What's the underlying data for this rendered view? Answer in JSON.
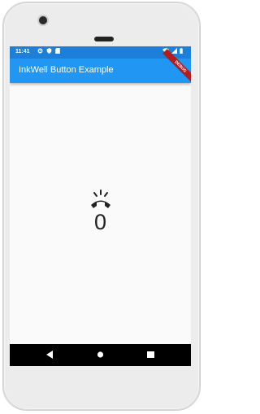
{
  "status_bar": {
    "time": "11:41"
  },
  "app_bar": {
    "title": "InkWell Button Example",
    "debug_label": "DEBUG"
  },
  "body": {
    "counter": "0",
    "icon": "ring-volume-icon"
  },
  "nav_bar": {
    "buttons": [
      "back",
      "home",
      "recents"
    ]
  },
  "colors": {
    "app_bar": "#2196f3",
    "status_bar": "#1e7fd8",
    "nav_bar": "#000000",
    "background": "#fafafa"
  }
}
